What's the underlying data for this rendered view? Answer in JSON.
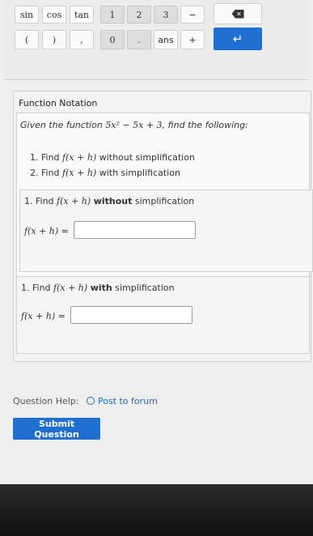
{
  "keypad": {
    "row1": [
      "sin",
      "cos",
      "tan"
    ],
    "digits_row1": [
      "1",
      "2",
      "3"
    ],
    "minus": "−",
    "backspace_glyph": "✕",
    "row2": [
      "(",
      ")",
      ","
    ],
    "digits_row2": [
      "0",
      "."
    ],
    "ans": "ans",
    "plus": "+",
    "enter_glyph": "↵"
  },
  "question": {
    "title": "Function Notation",
    "given_prefix": "Given the function ",
    "function_expr": "5x² − 5x + 3",
    "given_suffix": ", find the following:",
    "tasks": [
      {
        "num": "1.",
        "text": "Find ",
        "expr": "f(x + h)",
        "tail": " without simplification"
      },
      {
        "num": "2.",
        "text": "Find ",
        "expr": "f(x + h)",
        "tail": " with simplification"
      }
    ],
    "parts": [
      {
        "head_prefix": "1. Find ",
        "expr": "f(x + h)",
        "bold": "without",
        "tail": "simplification",
        "answer_label": "f(x + h) =",
        "value": ""
      },
      {
        "head_prefix": "1. Find ",
        "expr": "f(x + h)",
        "bold": "with",
        "tail": "simplification",
        "answer_label": "f(x + h) =",
        "value": ""
      }
    ]
  },
  "help": {
    "label": "Question Help:",
    "link": "Post to forum"
  },
  "submit_label": "Submit Question"
}
